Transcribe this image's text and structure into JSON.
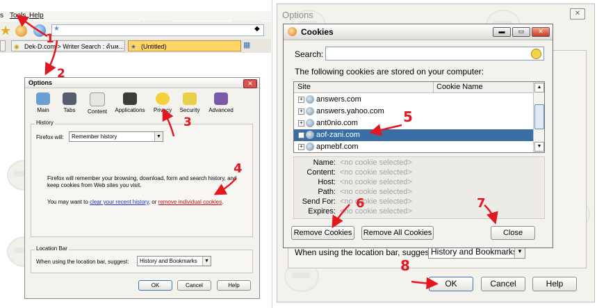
{
  "browser": {
    "menu": {
      "partial_left": "s",
      "tools": "Tools",
      "help": "Help"
    },
    "tabs": [
      {
        "label": "Dek-D.com > Writer Search : ค้นห..."
      },
      {
        "label": "(Untitled)"
      }
    ],
    "url_value": ""
  },
  "options_small": {
    "title": "Options",
    "close_glyph": "✕",
    "categories": [
      {
        "label": "Main",
        "icon": "main-icon",
        "color": "#6a9fd4"
      },
      {
        "label": "Tabs",
        "icon": "tabs-icon",
        "color": "#555d6e"
      },
      {
        "label": "Content",
        "icon": "content-icon",
        "color": "#e6e6e6"
      },
      {
        "label": "Applications",
        "icon": "applications-icon",
        "color": "#3b3b3b"
      },
      {
        "label": "Privacy",
        "icon": "privacy-icon",
        "color": "#f2d13c"
      },
      {
        "label": "Security",
        "icon": "security-icon",
        "color": "#e8d04a"
      },
      {
        "label": "Advanced",
        "icon": "advanced-icon",
        "color": "#7a5aa6"
      }
    ],
    "history": {
      "group_label": "History",
      "firefox_will_label": "Firefox will:",
      "firefox_will_underline": "w",
      "firefox_will_value": "Remember history",
      "description": "Firefox will remember your browsing, download, form and search history, and keep cookies from Web sites you visit.",
      "may_want_prefix": "You may want to ",
      "clear_link": "clear your recent history",
      "or_text": ", or ",
      "remove_link": "remove individual cookies",
      "period": "."
    },
    "location_bar": {
      "group_label": "Location Bar",
      "suggest_label": "When using the location bar, suggest:",
      "suggest_value": "History and Bookmarks"
    },
    "buttons": {
      "ok": "OK",
      "cancel": "Cancel",
      "help": "Help"
    }
  },
  "options_large": {
    "title": "Options",
    "close_glyph": "✕",
    "suggest_label": "When using the location bar, suggest:",
    "suggest_value": "History and Bookmarks",
    "buttons": {
      "ok": "OK",
      "cancel": "Cancel",
      "help": "Help"
    }
  },
  "cookies": {
    "title": "Cookies",
    "search_label": "Search:",
    "search_value": "",
    "stored_text": "The following cookies are stored on your computer:",
    "columns": {
      "site": "Site",
      "cookie_name": "Cookie Name"
    },
    "rows": [
      {
        "site": "answers.com"
      },
      {
        "site": "answers.yahoo.com"
      },
      {
        "site": "ant0nio.com"
      },
      {
        "site": "aof-zani.com"
      },
      {
        "site": "apmebf.com"
      }
    ],
    "selected_index": 3,
    "details": [
      {
        "label": "Name:",
        "value": "<no cookie selected>"
      },
      {
        "label": "Content:",
        "value": "<no cookie selected>"
      },
      {
        "label": "Host:",
        "value": "<no cookie selected>"
      },
      {
        "label": "Path:",
        "value": "<no cookie selected>"
      },
      {
        "label": "Send For:",
        "value": "<no cookie selected>"
      },
      {
        "label": "Expires:",
        "value": "<no cookie selected>"
      }
    ],
    "buttons": {
      "remove": "Remove Cookies",
      "remove_all": "Remove All Cookies",
      "close": "Close"
    },
    "window_glyphs": {
      "minimize": "▬",
      "maximize": "▭",
      "close": "✕"
    }
  },
  "annotations": {
    "steps": [
      "1",
      "2",
      "3",
      "4",
      "5",
      "6",
      "7",
      "8"
    ],
    "color": "#e2171f"
  }
}
